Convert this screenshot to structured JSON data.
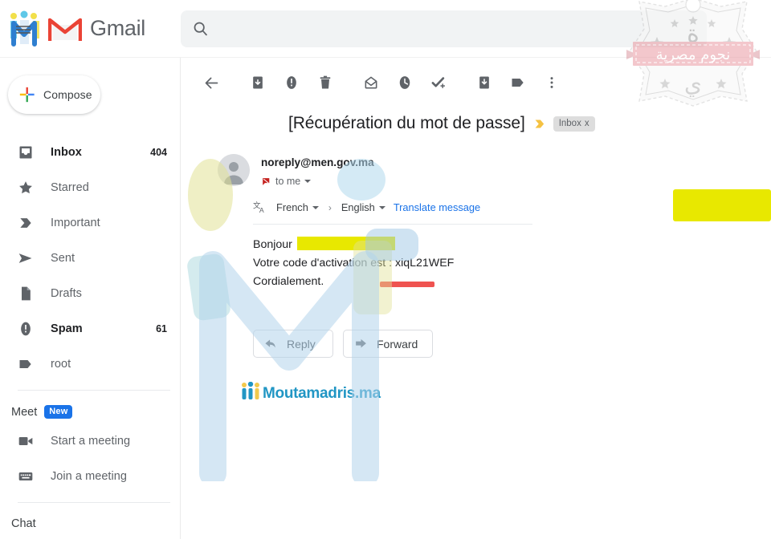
{
  "app": {
    "name": "Gmail",
    "brand_logo_icon": "moutamadris-people-icon",
    "gmail_logo_icon": "gmail-m-icon"
  },
  "search": {
    "placeholder": "",
    "value": "",
    "icon": "search-icon"
  },
  "sidebar": {
    "compose": {
      "label": "Compose",
      "icon": "plus-icon"
    },
    "items": [
      {
        "label": "Inbox",
        "count": "404",
        "icon": "inbox-icon",
        "active": true
      },
      {
        "label": "Starred",
        "count": "",
        "icon": "star-icon",
        "active": false
      },
      {
        "label": "Important",
        "count": "",
        "icon": "important-icon",
        "active": false
      },
      {
        "label": "Sent",
        "count": "",
        "icon": "send-icon",
        "active": false
      },
      {
        "label": "Drafts",
        "count": "",
        "icon": "draft-icon",
        "active": false
      },
      {
        "label": "Spam",
        "count": "61",
        "icon": "spam-icon",
        "active": true
      },
      {
        "label": "root",
        "count": "",
        "icon": "label-icon",
        "active": false
      }
    ],
    "meet": {
      "title": "Meet",
      "badge": "New",
      "items": [
        {
          "label": "Start a meeting",
          "icon": "video-camera-icon"
        },
        {
          "label": "Join a meeting",
          "icon": "keyboard-icon"
        }
      ]
    },
    "chat": {
      "title": "Chat"
    }
  },
  "toolbar": {
    "buttons": [
      {
        "name": "back-to-inbox",
        "icon": "arrow-left-icon"
      },
      {
        "name": "archive",
        "icon": "archive-icon"
      },
      {
        "name": "report-spam",
        "icon": "report-spam-icon"
      },
      {
        "name": "delete",
        "icon": "trash-icon"
      },
      {
        "name": "mark-unread",
        "icon": "mark-unread-icon"
      },
      {
        "name": "snooze",
        "icon": "clock-icon"
      },
      {
        "name": "add-to-tasks",
        "icon": "add-task-icon"
      },
      {
        "name": "move-to",
        "icon": "move-to-icon"
      },
      {
        "name": "labels",
        "icon": "label-icon"
      },
      {
        "name": "more-options",
        "icon": "more-vertical-icon"
      }
    ]
  },
  "email": {
    "subject": "[Récupération du mot de passe]",
    "important_marker_icon": "important-marker-icon",
    "label_chip": "Inbox",
    "label_chip_remove": "x",
    "sender": "noreply@men.gov.ma",
    "recipient": "to me",
    "recipient_icon": "no-reply-icon",
    "avatar_icon": "avatar-icon",
    "translate": {
      "icon": "translate-icon",
      "source_language": "French",
      "arrow": "›",
      "target_language": "English",
      "action": "Translate message"
    },
    "body": {
      "greeting": "Bonjour",
      "greeting_redacted": true,
      "activation_line": "Votre code d'activation est : xiqL21WEF",
      "activation_code": "xiqL21WEF",
      "closing": "Cordialement."
    },
    "actions": [
      {
        "label": "Reply",
        "icon": "reply-arrow-icon"
      },
      {
        "label": "Forward",
        "icon": "forward-arrow-icon"
      }
    ],
    "footer_logo": {
      "text": "Moutamadris.ma",
      "icon": "moutamadris-people-icon",
      "color": "#2196c4"
    }
  },
  "overlays": {
    "watermark_letter": "M",
    "watermark_color": "#b3d4ec",
    "stamp_text": "نجوم مصرية",
    "stamp_ribbon_color": "#e8a0a8",
    "redaction_color": "#e8e800",
    "code_underline_color": "#ef5350"
  }
}
